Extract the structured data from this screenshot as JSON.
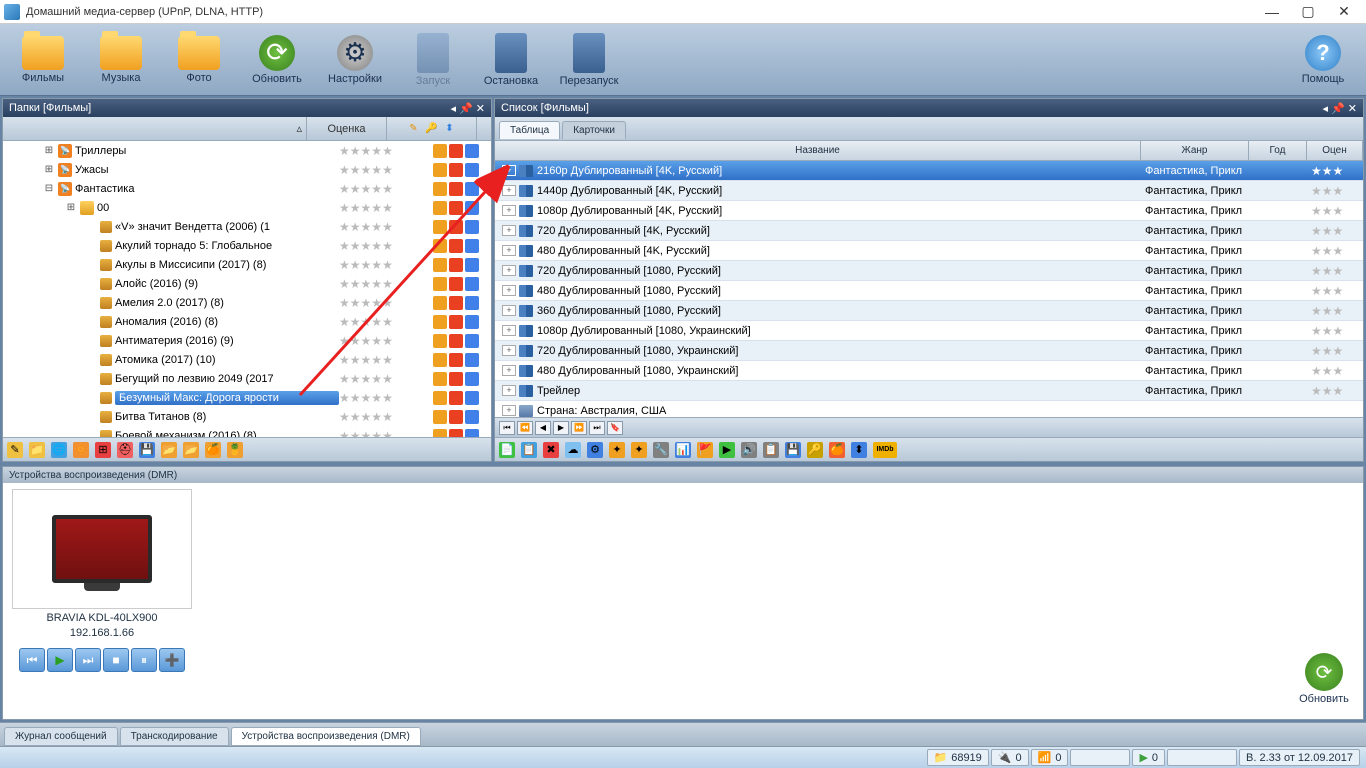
{
  "window": {
    "title": "Домашний медиа-сервер (UPnP, DLNA, HTTP)"
  },
  "toolbar": {
    "films": "Фильмы",
    "music": "Музыка",
    "photo": "Фото",
    "refresh": "Обновить",
    "settings": "Настройки",
    "start": "Запуск",
    "stop": "Остановка",
    "restart": "Перезапуск",
    "help": "Помощь"
  },
  "left_panel": {
    "title": "Папки [Фильмы]",
    "col_rating": "Оценка"
  },
  "tree": [
    {
      "indent": 40,
      "exp": "+",
      "ico": "rss",
      "label": "Триллеры"
    },
    {
      "indent": 40,
      "exp": "+",
      "ico": "rss",
      "label": "Ужасы"
    },
    {
      "indent": 40,
      "exp": "-",
      "ico": "rss",
      "label": "Фантастика"
    },
    {
      "indent": 62,
      "exp": "+",
      "ico": "fold",
      "label": "00"
    },
    {
      "indent": 82,
      "exp": "",
      "ico": "box",
      "label": "«V» значит Вендетта (2006) (1"
    },
    {
      "indent": 82,
      "exp": "",
      "ico": "box",
      "label": "Акулий торнадо 5: Глобальное"
    },
    {
      "indent": 82,
      "exp": "",
      "ico": "box",
      "label": "Акулы в Миссисипи (2017) (8)"
    },
    {
      "indent": 82,
      "exp": "",
      "ico": "box",
      "label": "Алойс (2016) (9)"
    },
    {
      "indent": 82,
      "exp": "",
      "ico": "box",
      "label": "Амелия 2.0 (2017) (8)"
    },
    {
      "indent": 82,
      "exp": "",
      "ico": "box",
      "label": "Аномалия (2016) (8)"
    },
    {
      "indent": 82,
      "exp": "",
      "ico": "box",
      "label": "Антиматерия (2016) (9)"
    },
    {
      "indent": 82,
      "exp": "",
      "ico": "box",
      "label": "Атомика (2017) (10)"
    },
    {
      "indent": 82,
      "exp": "",
      "ico": "box",
      "label": "Бегущий по лезвию 2049 (2017"
    },
    {
      "indent": 82,
      "exp": "",
      "ico": "box",
      "label": "Безумный Макс: Дорога ярости",
      "sel": true
    },
    {
      "indent": 82,
      "exp": "",
      "ico": "box",
      "label": "Битва Титанов (8)"
    },
    {
      "indent": 82,
      "exp": "",
      "ico": "box",
      "label": "Боевой механизм (2016) (8)"
    }
  ],
  "right_panel": {
    "title": "Список [Фильмы]",
    "tab_table": "Таблица",
    "tab_cards": "Карточки",
    "col_name": "Название",
    "col_genre": "Жанр",
    "col_year": "Год",
    "col_rating": "Оцен"
  },
  "rows": [
    {
      "name": "2160p Дублированный [4K, Русский]",
      "genre": "Фантастика, Прикл",
      "sel": true,
      "ico": "vid"
    },
    {
      "name": "1440p Дублированный [4K, Русский]",
      "genre": "Фантастика, Прикл",
      "ico": "vid"
    },
    {
      "name": "1080p Дублированный [4K, Русский]",
      "genre": "Фантастика, Прикл",
      "ico": "vid"
    },
    {
      "name": "720 Дублированный [4K, Русский]",
      "genre": "Фантастика, Прикл",
      "ico": "vid"
    },
    {
      "name": "480 Дублированный [4K, Русский]",
      "genre": "Фантастика, Прикл",
      "ico": "vid"
    },
    {
      "name": "720 Дублированный [1080, Русский]",
      "genre": "Фантастика, Прикл",
      "ico": "vid"
    },
    {
      "name": "480 Дублированный [1080, Русский]",
      "genre": "Фантастика, Прикл",
      "ico": "vid"
    },
    {
      "name": "360 Дублированный [1080, Русский]",
      "genre": "Фантастика, Прикл",
      "ico": "vid"
    },
    {
      "name": "1080p Дублированный [1080, Украинский]",
      "genre": "Фантастика, Прикл",
      "ico": "vid"
    },
    {
      "name": "720 Дублированный [1080, Украинский]",
      "genre": "Фантастика, Прикл",
      "ico": "vid"
    },
    {
      "name": "480 Дублированный [1080, Украинский]",
      "genre": "Фантастика, Прикл",
      "ico": "vid"
    },
    {
      "name": "Трейлер",
      "genre": "Фантастика, Прикл",
      "ico": "vid"
    },
    {
      "name": "Страна: Австралия,  США",
      "genre": "",
      "ico": "tbl"
    }
  ],
  "dmr": {
    "title": "Устройства воспроизведения (DMR)",
    "device": "BRAVIA KDL-40LX900",
    "ip": "192.168.1.66",
    "refresh": "Обновить"
  },
  "bottom_tabs": {
    "journal": "Журнал сообщений",
    "transcode": "Транскодирование",
    "dmr": "Устройства воспроизведения (DMR)"
  },
  "status": {
    "count1": "68919",
    "count2": "0",
    "count3": "0",
    "zero": "0",
    "version": "B.  2.33 от 12.09.2017"
  }
}
